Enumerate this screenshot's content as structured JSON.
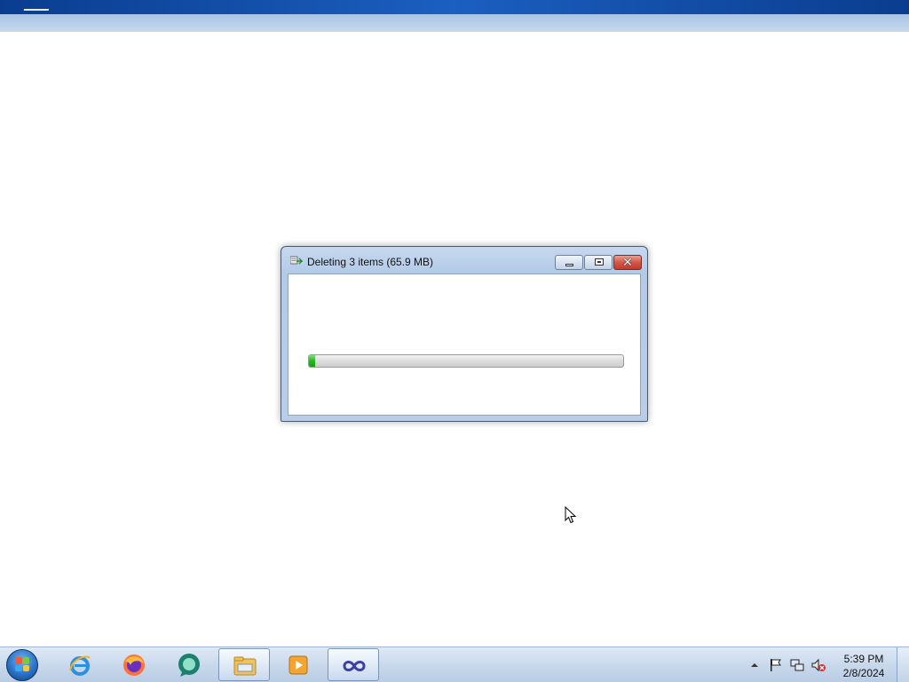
{
  "dialog": {
    "title": "Deleting 3 items (65.9 MB)",
    "progress_fraction": 0.02,
    "icons": {
      "title": "delete-progress-icon",
      "minimize": "minimize-icon",
      "maximize": "maximize-icon",
      "close": "close-icon"
    },
    "close_glyph": "✕"
  },
  "taskbar": {
    "start": "windows-start-icon",
    "pinned": [
      {
        "name": "internet-explorer",
        "icon": "internet-explorer-icon"
      },
      {
        "name": "firefox",
        "icon": "firefox-icon"
      },
      {
        "name": "chat-app",
        "icon": "chat-bubble-icon"
      },
      {
        "name": "file-explorer",
        "icon": "folder-icon",
        "active": true
      },
      {
        "name": "media-player",
        "icon": "media-player-icon"
      },
      {
        "name": "infinity-app",
        "icon": "infinity-icon",
        "active": true
      }
    ],
    "tray": {
      "icons": [
        "show-hidden-icons-icon",
        "action-center-flag-icon",
        "network-icon",
        "volume-muted-icon"
      ],
      "time": "5:39 PM",
      "date": "2/8/2024"
    }
  },
  "colors": {
    "progress": "#27b427",
    "close_button": "#c23a2c",
    "titlebar": "#b9cde8",
    "taskbar": "#c9d9ec"
  }
}
